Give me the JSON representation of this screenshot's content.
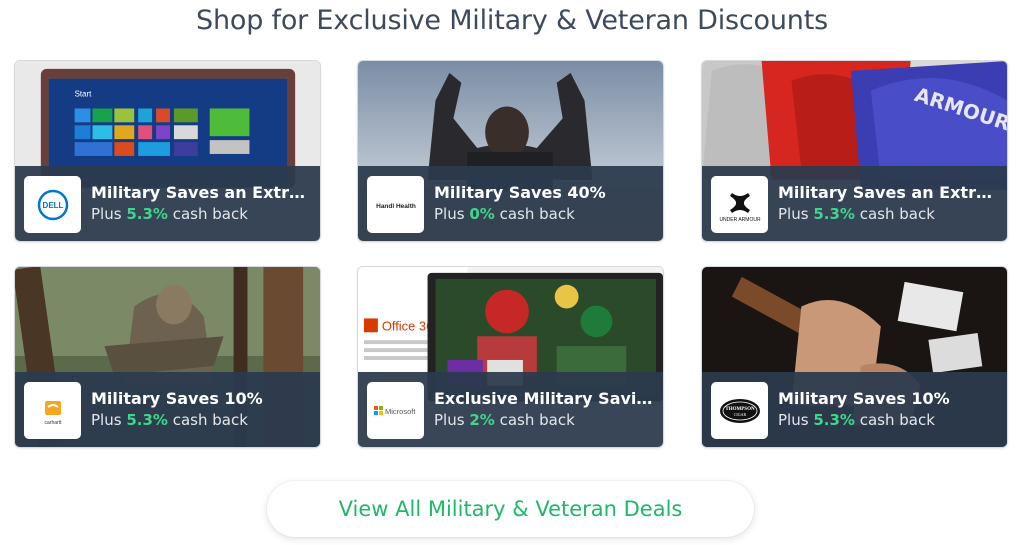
{
  "header": {
    "title": "Shop for Exclusive Military & Veteran Discounts"
  },
  "cashback_prefix": "Plus",
  "cashback_suffix": "cash back",
  "accent_color": "#3fd58b",
  "deals": [
    {
      "store_icon": "dell-logo-icon",
      "logo_text": "DELL",
      "title": "Military Saves an Extra ...",
      "cashback": "5.3%",
      "image": "windows-laptop-photo"
    },
    {
      "store_icon": "handl-health-logo-icon",
      "logo_text": "Handl Health",
      "title": "Military Saves 40%",
      "cashback": "0%",
      "image": "man-raising-arms-photo"
    },
    {
      "store_icon": "under-armour-logo-icon",
      "logo_text": "UNDER ARMOUR",
      "title": "Military Saves an Extra ...",
      "cashback": "5.3%",
      "image": "under-armour-hoodies-photo"
    },
    {
      "store_icon": "carhartt-logo-icon",
      "logo_text": "carhartt",
      "title": "Military Saves 10%",
      "cashback": "5.3%",
      "image": "hunter-in-tree-photo"
    },
    {
      "store_icon": "microsoft-logo-icon",
      "logo_text": "Microsoft",
      "title": "Exclusive Military Savings",
      "cashback": "2%",
      "image": "office-365-tablet-photo"
    },
    {
      "store_icon": "thompson-cigar-logo-icon",
      "logo_text": "THOMPSON CIGAR",
      "title": "Military Saves 10%",
      "cashback": "5.3%",
      "image": "cigar-lighting-photo"
    }
  ],
  "footer": {
    "view_all_label": "View All Military & Veteran Deals"
  }
}
